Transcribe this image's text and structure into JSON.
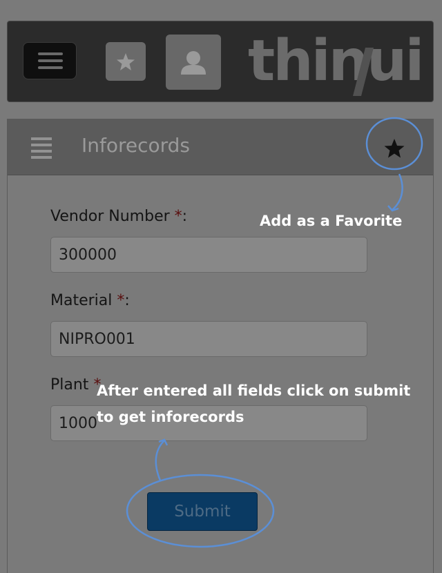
{
  "app_bar": {
    "logo_text": "thinui",
    "icons": [
      "menu-icon",
      "star-icon",
      "user-icon"
    ]
  },
  "page": {
    "title": "Inforecords",
    "header_icons": [
      "list-icon",
      "star-icon"
    ]
  },
  "form": {
    "vendor_label": "Vendor Number ",
    "vendor_required": "*",
    "vendor_suffix": ":",
    "vendor_value": "300000",
    "material_label": "Material ",
    "material_required": "*",
    "material_suffix": ":",
    "material_value": "NIPRO001",
    "plant_label": "Plant ",
    "plant_required": "*",
    "plant_value": "1000",
    "submit_label": "Submit"
  },
  "annotations": {
    "favorite_tip": "Add as a Favorite",
    "submit_tip_line1": "After entered all fields click on submit",
    "submit_tip_line2": "to get inforecords",
    "callout_color": "#5b8fd6"
  },
  "colors": {
    "background": "#7a7a7a",
    "app_bar": "#2b2b2b",
    "header": "#5b5b5b",
    "submit": "#0a3a63",
    "required": "#5a0e0e"
  }
}
